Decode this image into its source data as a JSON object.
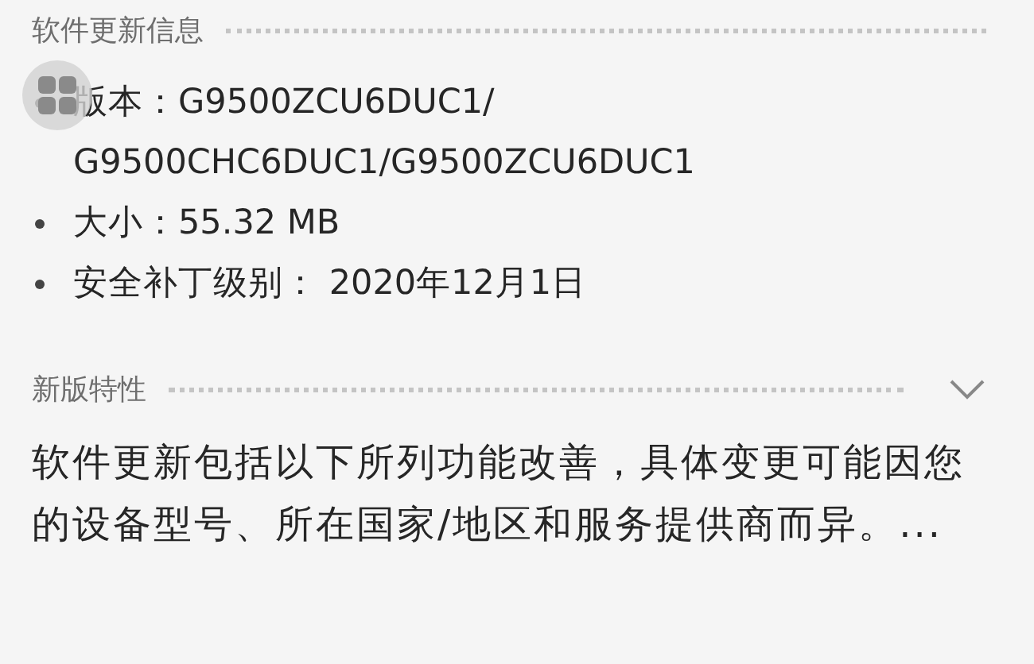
{
  "update_info": {
    "title": "软件更新信息",
    "items": [
      {
        "text": "版本：G9500ZCU6DUC1/ G9500CHC6DUC1/G9500ZCU6DUC1"
      },
      {
        "text": "大小：55.32 MB"
      },
      {
        "text": "安全补丁级别： 2020年12月1日"
      }
    ]
  },
  "whats_new": {
    "title": "新版特性",
    "expanded": false,
    "text": "软件更新包括以下所列功能改善，具体变更可能因您的设备型号、所在国家/地区和服务提供商而异。..."
  }
}
